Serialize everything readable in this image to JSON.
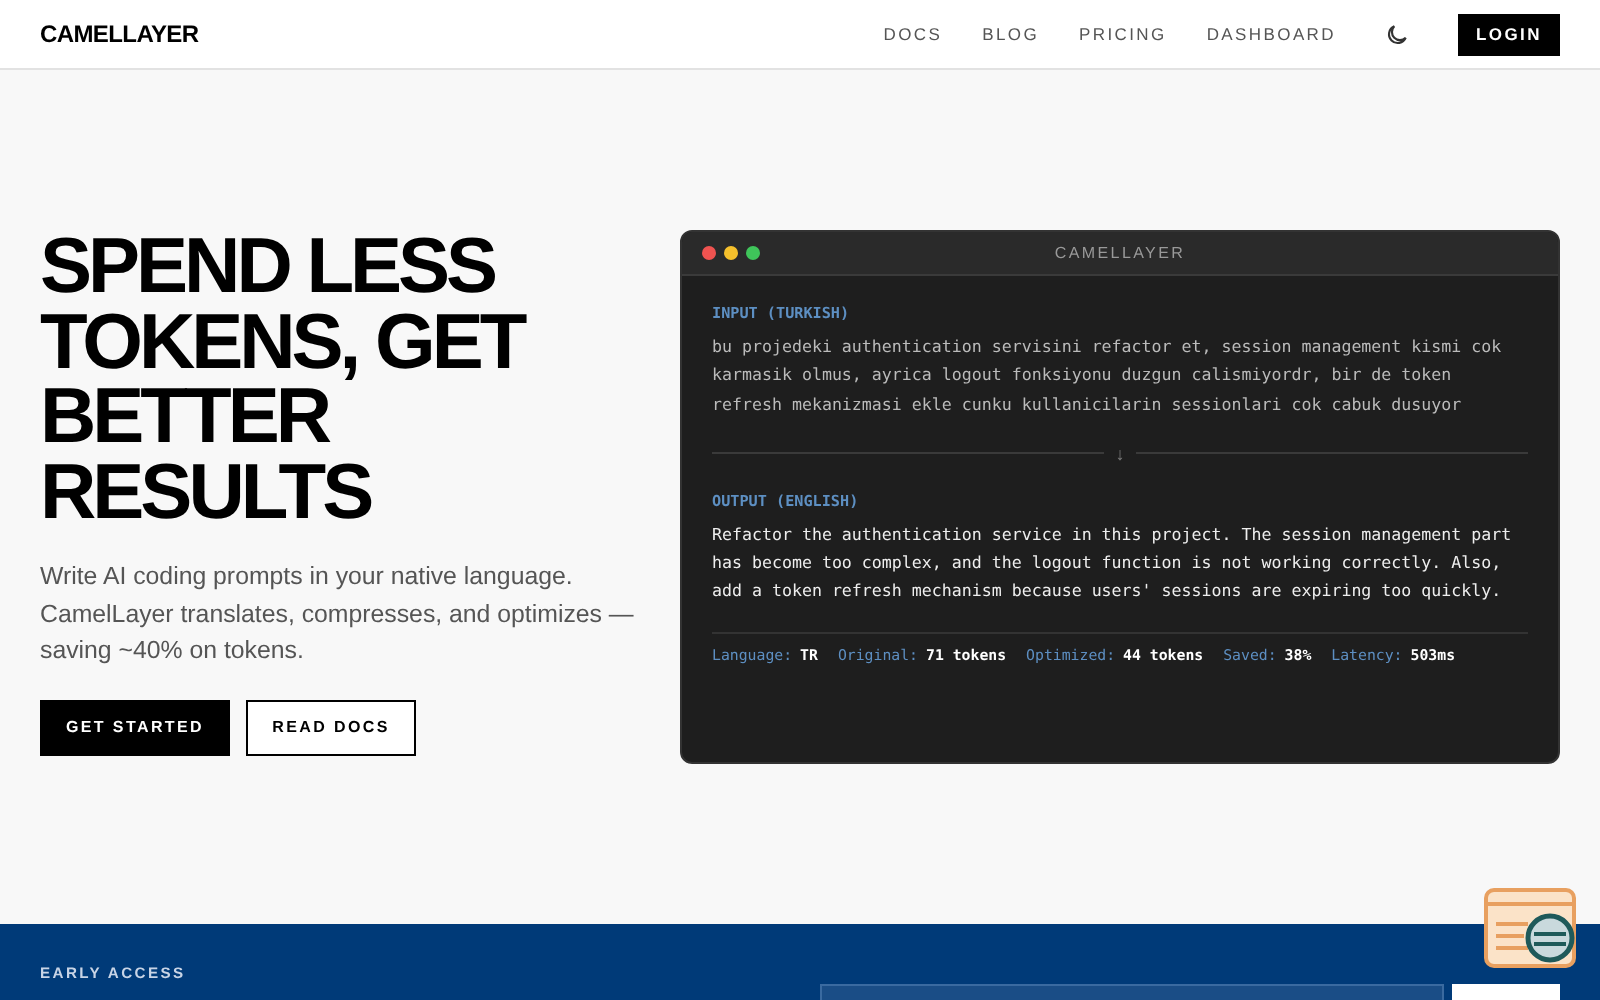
{
  "header": {
    "logo": "CAMELLAYER",
    "nav": [
      {
        "label": "DOCS"
      },
      {
        "label": "BLOG"
      },
      {
        "label": "PRICING"
      },
      {
        "label": "DASHBOARD"
      }
    ],
    "login": "LOGIN"
  },
  "hero": {
    "headline": "SPEND LESS TOKENS, GET BETTER RESULTS",
    "description": "Write AI coding prompts in your native language. CamelLayer translates, compresses, and optimizes — saving ~40% on tokens.",
    "buttons": [
      {
        "label": "GET STARTED",
        "kind": "primary"
      },
      {
        "label": "READ DOCS",
        "kind": "secondary"
      }
    ]
  },
  "terminal": {
    "title": "CAMELLAYER",
    "input_label": "INPUT (TURKISH)",
    "input_text": "bu projedeki authentication servisini refactor et, session management kismi cok karmasik olmus, ayrica logout fonksiyonu duzgun calismiyordr, bir de token refresh mekanizmasi ekle cunku kullanicilarin sessionlari cok cabuk dusuyor",
    "divider": "↓",
    "output_label": "OUTPUT (ENGLISH)",
    "output_text": "Refactor the authentication service in this project. The session management part has become too complex, and the logout function is not working correctly. Also, add a token refresh mechanism because users' sessions are expiring too quickly.",
    "stats": [
      {
        "label": "Language:",
        "value": "TR"
      },
      {
        "label": "Original:",
        "value": "71 tokens"
      },
      {
        "label": "Optimized:",
        "value": "44 tokens"
      },
      {
        "label": "Saved:",
        "value": "38%"
      },
      {
        "label": "Latency:",
        "value": "503ms"
      }
    ]
  },
  "early_access": {
    "label": "EARLY ACCESS"
  }
}
